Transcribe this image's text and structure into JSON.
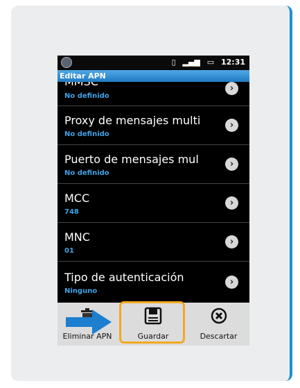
{
  "statusbar": {
    "time": "12:31",
    "icons": [
      "sync-icon",
      "signal-icon",
      "battery-icon"
    ]
  },
  "titlebar": {
    "title": "Editar APN"
  },
  "list": [
    {
      "title": "MMSC",
      "value": "No definido"
    },
    {
      "title": "Proxy de mensajes multi",
      "value": "No definido"
    },
    {
      "title": "Puerto de mensajes mul",
      "value": "No definido"
    },
    {
      "title": "MCC",
      "value": "748"
    },
    {
      "title": "MNC",
      "value": "01"
    },
    {
      "title": "Tipo de autenticación",
      "value": "Ninguno"
    }
  ],
  "bottom_buttons": [
    {
      "label": "Eliminar APN",
      "icon": "trash-icon"
    },
    {
      "label": "Guardar",
      "icon": "save-icon"
    },
    {
      "label": "Descartar",
      "icon": "discard-icon"
    }
  ],
  "colors": {
    "accent": "#1a8fd6",
    "highlight": "#f3a823",
    "value_text": "#3ea4e8"
  }
}
